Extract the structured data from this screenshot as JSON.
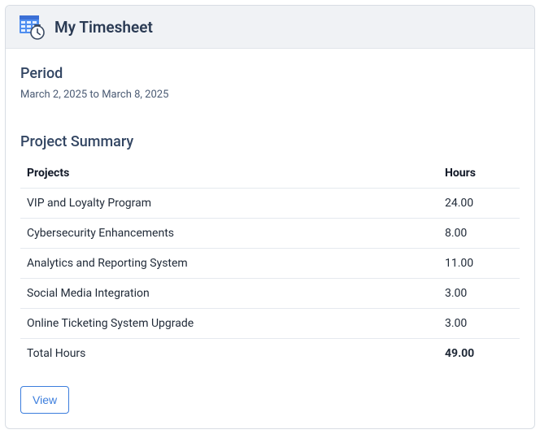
{
  "header": {
    "title": "My Timesheet"
  },
  "period": {
    "label": "Period",
    "text": "March 2, 2025 to March 8, 2025"
  },
  "summary": {
    "label": "Project Summary",
    "columns": {
      "project": "Projects",
      "hours": "Hours"
    },
    "rows": [
      {
        "project": "VIP and Loyalty Program",
        "hours": "24.00"
      },
      {
        "project": "Cybersecurity Enhancements",
        "hours": "8.00"
      },
      {
        "project": "Analytics and Reporting System",
        "hours": "11.00"
      },
      {
        "project": "Social Media Integration",
        "hours": "3.00"
      },
      {
        "project": "Online Ticketing System Upgrade",
        "hours": "3.00"
      }
    ],
    "total": {
      "label": "Total Hours",
      "hours": "49.00"
    }
  },
  "actions": {
    "view": "View"
  }
}
